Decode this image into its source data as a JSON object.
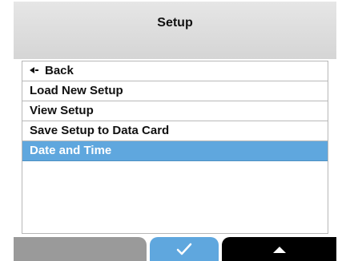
{
  "header": {
    "title": "Setup"
  },
  "menu": {
    "items": [
      {
        "label": "Back",
        "icon": "back-arrow-icon",
        "selected": false
      },
      {
        "label": "Load New Setup",
        "selected": false
      },
      {
        "label": "View Setup",
        "selected": false
      },
      {
        "label": "Save Setup to Data Card",
        "selected": false
      },
      {
        "label": "Date and Time",
        "selected": true
      }
    ]
  },
  "softkeys": {
    "left": {
      "label": ""
    },
    "middle": {
      "icon": "checkmark-icon"
    },
    "right": {
      "icon": "up-arrow-icon"
    }
  },
  "colors": {
    "header_background": "#dcdcdc",
    "selected_background": "#5fa7de",
    "left_softkey": "#9a9a9a",
    "right_softkey": "#000000"
  }
}
